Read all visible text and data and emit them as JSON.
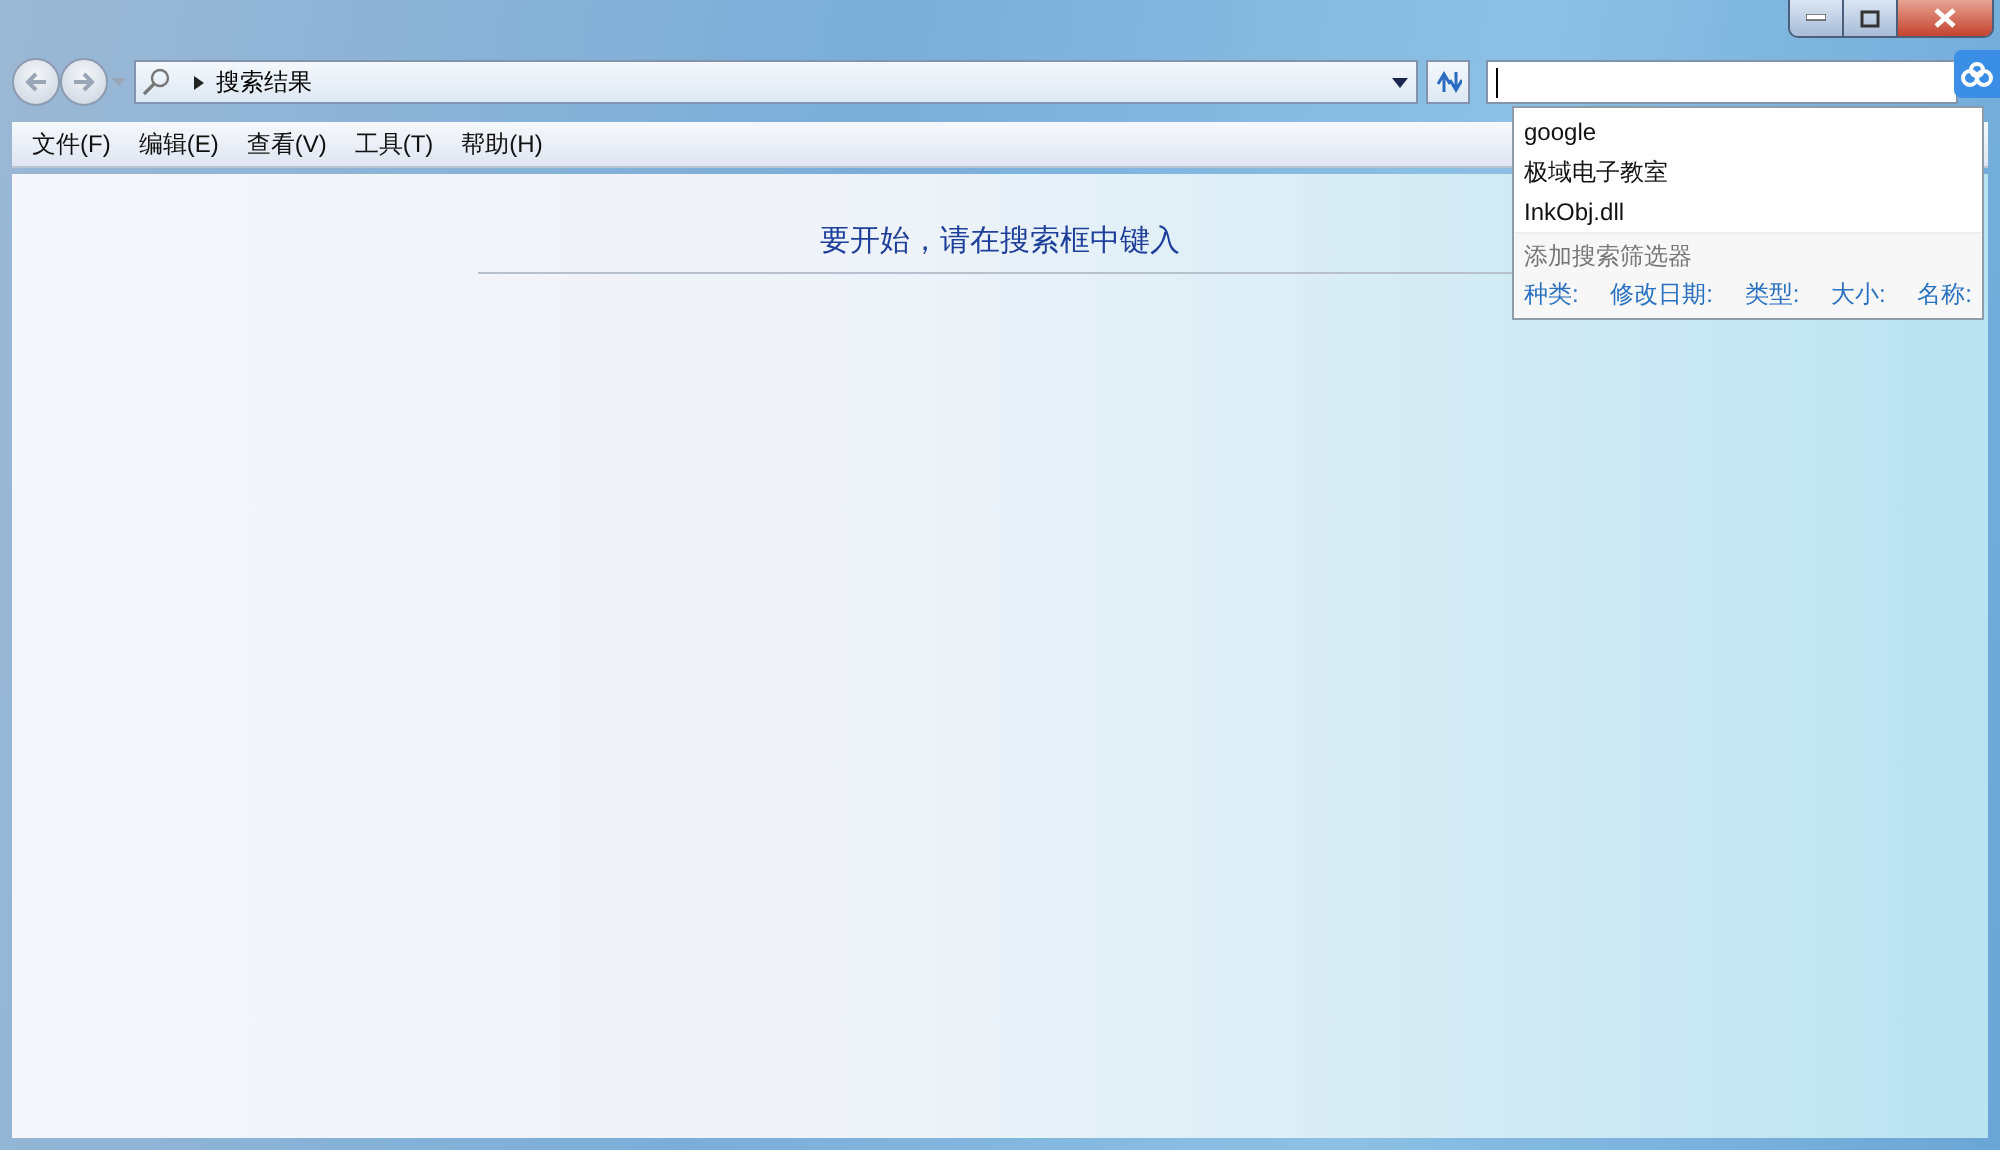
{
  "address": {
    "path": "搜索结果"
  },
  "menu": [
    "文件(F)",
    "编辑(E)",
    "查看(V)",
    "工具(T)",
    "帮助(H)"
  ],
  "content": {
    "message": "要开始，请在搜索框中键入"
  },
  "search_dropdown": {
    "suggestions": [
      "google",
      "极域电子教室",
      "InkObj.dll"
    ],
    "filter_heading": "添加搜索筛选器",
    "filters": [
      "种类:",
      "修改日期:",
      "类型:",
      "大小:",
      "名称:"
    ]
  }
}
